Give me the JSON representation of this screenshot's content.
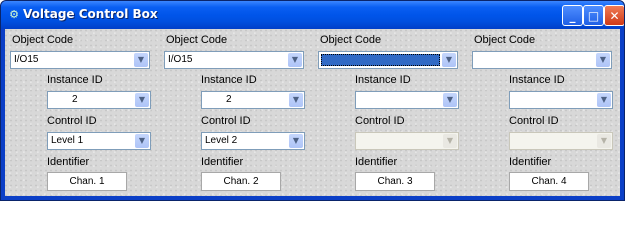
{
  "window": {
    "title": "Voltage Control Box"
  },
  "title_buttons": {
    "minimize": "_",
    "maximize": "□",
    "close": "✕"
  },
  "columns": [
    {
      "object_code_label": "Object Code",
      "object_code": "I/O15",
      "instance_label": "Instance ID",
      "instance": "2",
      "control_label": "Control ID",
      "control": "Level 1",
      "identifier_label": "Identifier",
      "identifier": "Chan. 1"
    },
    {
      "object_code_label": "Object Code",
      "object_code": "I/O15",
      "instance_label": "Instance ID",
      "instance": "2",
      "control_label": "Control ID",
      "control": "Level 2",
      "identifier_label": "Identifier",
      "identifier": "Chan. 2"
    },
    {
      "object_code_label": "Object Code",
      "object_code": "",
      "instance_label": "Instance ID",
      "instance": "",
      "control_label": "Control ID",
      "control": "",
      "identifier_label": "Identifier",
      "identifier": "Chan. 3"
    },
    {
      "object_code_label": "Object Code",
      "object_code": "",
      "instance_label": "Instance ID",
      "instance": "",
      "control_label": "Control ID",
      "control": "",
      "identifier_label": "Identifier",
      "identifier": "Chan. 4"
    }
  ],
  "colors": {
    "titlebar": "#0055ea",
    "selection": "#316ac5",
    "combo_border": "#7f9db9"
  },
  "icons": {
    "window_icon": "app-icon",
    "dropdown": "chevron-down-icon"
  }
}
